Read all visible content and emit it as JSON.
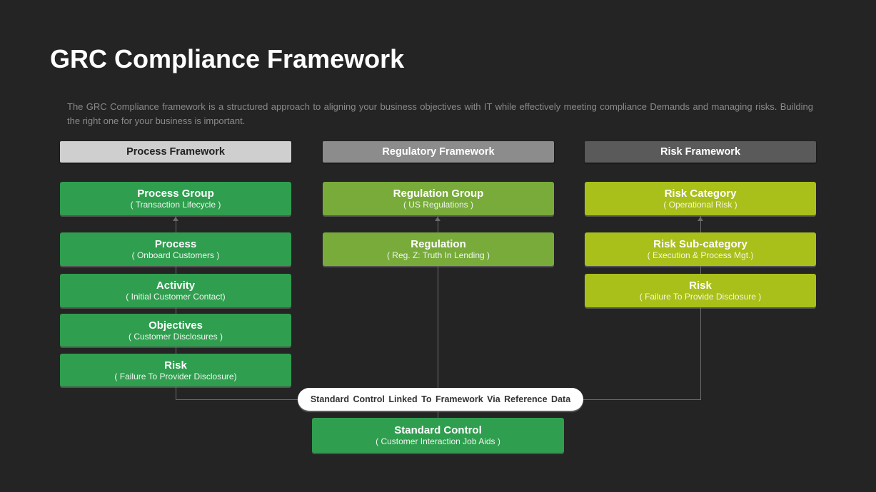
{
  "title": "GRC Compliance Framework",
  "description": "The GRC Compliance framework is a structured approach to aligning your business objectives with IT while effectively meeting compliance Demands and managing risks. Building the right one for your business is important.",
  "colors": {
    "background": "#242424",
    "process_green": "#2f9e4f",
    "regulatory_green": "#78ab3a",
    "risk_lime": "#a9bf1a"
  },
  "columns": [
    {
      "header": "Process Framework",
      "items": [
        {
          "title": "Process Group",
          "subtitle": "( Transaction Lifecycle )"
        },
        {
          "title": "Process",
          "subtitle": "( Onboard Customers )"
        },
        {
          "title": "Activity",
          "subtitle": "( Initial Customer  Contact)"
        },
        {
          "title": "Objectives",
          "subtitle": "( Customer Disclosures )"
        },
        {
          "title": "Risk",
          "subtitle": "( Failure To Provider Disclosure)"
        }
      ]
    },
    {
      "header": "Regulatory Framework",
      "items": [
        {
          "title": "Regulation Group",
          "subtitle": "( US Regulations )"
        },
        {
          "title": "Regulation",
          "subtitle": "( Reg. Z: Truth In Lending )"
        }
      ]
    },
    {
      "header": "Risk Framework",
      "items": [
        {
          "title": "Risk Category",
          "subtitle": "( Operational Risk )"
        },
        {
          "title": "Risk Sub-category",
          "subtitle": "( Execution & Process Mgt.)"
        },
        {
          "title": "Risk",
          "subtitle": "( Failure To Provide Disclosure )"
        }
      ]
    }
  ],
  "link_label": "Standard Control Linked To Framework Via Reference Data",
  "standard_control": {
    "title": "Standard Control",
    "subtitle": "( Customer Interaction Job Aids )"
  }
}
